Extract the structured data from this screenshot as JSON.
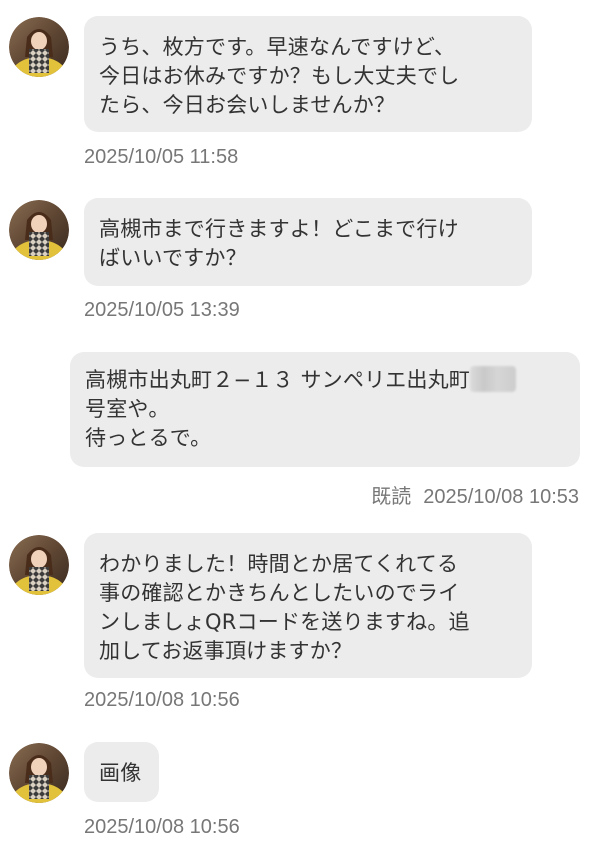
{
  "colors": {
    "bubble_bg": "#ececec",
    "text": "#333333",
    "timestamp": "#777777"
  },
  "icons": {
    "avatar": "sender-avatar-photo",
    "redaction": "blurred-room-number"
  },
  "messages": [
    {
      "side": "received",
      "lines": [
        "うち、枚方です。早速なんですけど、",
        "今日はお休みですか？もし大丈夫でし",
        "たら、今日お会いしませんか？"
      ],
      "timestamp": "2025/10/05 11:58"
    },
    {
      "side": "received",
      "lines": [
        "高槻市まで行きますよ！どこまで行け",
        "ばいいですか？"
      ],
      "timestamp": "2025/10/05 13:39"
    },
    {
      "side": "sent",
      "lines": [
        "高槻市出丸町２−１３ サンペリエ出丸町",
        "号室や。",
        "待っとるで。"
      ],
      "read_label": "既読",
      "timestamp": "2025/10/08 10:53"
    },
    {
      "side": "received",
      "lines": [
        "わかりました！時間とか居てくれてる",
        "事の確認とかきちんとしたいのでライ",
        "ンしましょQRコードを送りますね。追",
        "加してお返事頂けますか？"
      ],
      "timestamp": "2025/10/08 10:56"
    },
    {
      "side": "received",
      "lines": [
        "画像"
      ],
      "timestamp": "2025/10/08 10:56"
    }
  ]
}
